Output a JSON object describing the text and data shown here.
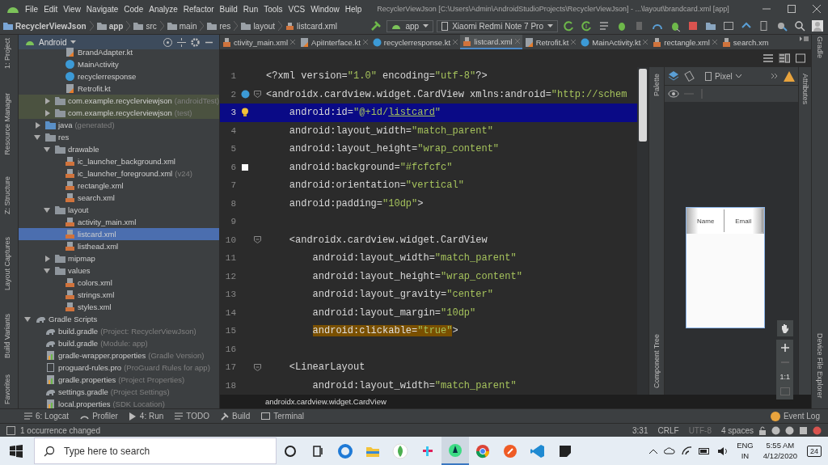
{
  "menu_bar": {
    "items": [
      "File",
      "Edit",
      "View",
      "Navigate",
      "Code",
      "Analyze",
      "Refactor",
      "Build",
      "Run",
      "Tools",
      "VCS",
      "Window",
      "Help"
    ],
    "title": "RecyclerViewJson [C:\\Users\\Admin\\AndroidStudioProjects\\RecyclerViewJson] - ...\\layout\\brandcard.xml [app]"
  },
  "breadcrumbs": [
    {
      "label": "RecyclerViewJson",
      "kind": "project"
    },
    {
      "label": "app",
      "kind": "module"
    },
    {
      "label": "src",
      "kind": "folder"
    },
    {
      "label": "main",
      "kind": "folder"
    },
    {
      "label": "res",
      "kind": "res"
    },
    {
      "label": "layout",
      "kind": "folder"
    },
    {
      "label": "listcard.xml",
      "kind": "xml"
    }
  ],
  "toolbar": {
    "run_config": "app",
    "device": "Xiaomi Redmi Note 7 Pro"
  },
  "left_strip": [
    "1: Project",
    "Resource Manager",
    "Z: Structure",
    "Layout Captures",
    "Build Variants",
    "Favorites"
  ],
  "project": {
    "view": "Android",
    "tree": [
      {
        "children": [
          {
            "children": [
              {
                "children": [
                  {
                    "label": "BrandAdapter.kt",
                    "kind": "kotlin",
                    "selected": false
                  },
                  {
                    "label": "MainActivity",
                    "kind": "class",
                    "selected": false
                  },
                  {
                    "label": "recyclerresponse",
                    "kind": "class",
                    "selected": false
                  },
                  {
                    "label": "Retrofit.kt",
                    "kind": "kotlin",
                    "selected": false
                  }
                ]
              },
              {
                "label": "com.example.recyclerviewjson",
                "note": "(androidTest)",
                "kind": "test-package",
                "expanded": false,
                "selected": false
              },
              {
                "label": "com.example.recyclerviewjson",
                "note": "(test)",
                "kind": "test-package",
                "expanded": false,
                "selected": false
              }
            ]
          },
          {
            "label": "java",
            "note": "(generated)",
            "kind": "generated",
            "expanded": false,
            "selected": false
          },
          {
            "label": "res",
            "kind": "res",
            "expanded": true,
            "selected": false,
            "children": [
              {
                "label": "drawable",
                "kind": "folder",
                "expanded": true,
                "selected": false,
                "children": [
                  {
                    "label": "ic_launcher_background.xml",
                    "kind": "xml",
                    "selected": false
                  },
                  {
                    "label": "ic_launcher_foreground.xml",
                    "note": "(v24)",
                    "kind": "xml",
                    "selected": false
                  },
                  {
                    "label": "rectangle.xml",
                    "kind": "xml",
                    "selected": false
                  },
                  {
                    "label": "search.xml",
                    "kind": "xml",
                    "selected": false
                  }
                ]
              },
              {
                "label": "layout",
                "kind": "folder",
                "expanded": true,
                "selected": false,
                "children": [
                  {
                    "label": "activity_main.xml",
                    "kind": "xml",
                    "selected": false
                  },
                  {
                    "label": "listcard.xml",
                    "kind": "xml",
                    "selected": true
                  },
                  {
                    "label": "listhead.xml",
                    "kind": "xml",
                    "selected": false
                  }
                ]
              },
              {
                "label": "mipmap",
                "kind": "folder",
                "expanded": false,
                "selected": false
              },
              {
                "label": "values",
                "kind": "folder",
                "expanded": true,
                "selected": false,
                "children": [
                  {
                    "label": "colors.xml",
                    "kind": "xml",
                    "selected": false
                  },
                  {
                    "label": "strings.xml",
                    "kind": "xml",
                    "selected": false
                  },
                  {
                    "label": "styles.xml",
                    "kind": "xml",
                    "selected": false
                  }
                ]
              }
            ]
          }
        ]
      },
      {
        "label": "Gradle Scripts",
        "kind": "gradle",
        "expanded": true,
        "selected": false,
        "children": [
          {
            "label": "build.gradle",
            "note": "(Project: RecyclerViewJson)",
            "kind": "gradle",
            "selected": false
          },
          {
            "label": "build.gradle",
            "note": "(Module: app)",
            "kind": "gradle",
            "selected": false
          },
          {
            "label": "gradle-wrapper.properties",
            "note": "(Gradle Version)",
            "kind": "props",
            "selected": false
          },
          {
            "label": "proguard-rules.pro",
            "note": "(ProGuard Rules for app)",
            "kind": "file",
            "selected": false
          },
          {
            "label": "gradle.properties",
            "note": "(Project Properties)",
            "kind": "props",
            "selected": false
          },
          {
            "label": "settings.gradle",
            "note": "(Project Settings)",
            "kind": "gradle",
            "selected": false
          },
          {
            "label": "local.properties",
            "note": "(SDK Location)",
            "kind": "props",
            "selected": false
          }
        ]
      }
    ]
  },
  "tabs": [
    {
      "label": "ctivity_main.xml",
      "kind": "xml",
      "selected": false
    },
    {
      "label": "ApiInterface.kt",
      "kind": "kotlin",
      "selected": false
    },
    {
      "label": "recyclerresponse.kt",
      "kind": "class",
      "selected": false
    },
    {
      "label": "listcard.xml",
      "kind": "xml",
      "selected": true
    },
    {
      "label": "Retrofit.kt",
      "kind": "kotlin",
      "selected": false
    },
    {
      "label": "MainActivity.kt",
      "kind": "class",
      "selected": false
    },
    {
      "label": "rectangle.xml",
      "kind": "xml",
      "selected": false
    },
    {
      "label": "search.xm",
      "kind": "xml",
      "selected": false
    }
  ],
  "editor": {
    "lines": [
      {
        "number": "1",
        "kind": "plain",
        "current": false,
        "fold": false,
        "tokens": [
          {
            "kind": "text",
            "text": "<?xml version="
          },
          {
            "kind": "value",
            "text": "\"1.0\""
          },
          {
            "kind": "text",
            "text": " encoding="
          },
          {
            "kind": "value",
            "text": "\"utf-8\""
          },
          {
            "kind": "text",
            "text": "?>"
          }
        ]
      },
      {
        "number": "2",
        "kind": "class-marker",
        "current": false,
        "fold": true,
        "tokens": [
          {
            "kind": "text",
            "text": "<androidx.cardview.widget.CardView xmlns:android="
          },
          {
            "kind": "value",
            "text": "\"http://schem"
          }
        ]
      },
      {
        "number": "3",
        "kind": "bulb-marker",
        "current": true,
        "fold": false,
        "tokens": [
          {
            "kind": "text",
            "text": "    android:id="
          },
          {
            "kind": "value",
            "text": "\"@+id/"
          },
          {
            "kind": "link",
            "text": "listcard"
          },
          {
            "kind": "value",
            "text": "\""
          }
        ]
      },
      {
        "number": "4",
        "kind": "plain",
        "current": false,
        "fold": false,
        "tokens": [
          {
            "kind": "text",
            "text": "    android:layout_width="
          },
          {
            "kind": "value",
            "text": "\"match_parent\""
          }
        ]
      },
      {
        "number": "5",
        "kind": "plain",
        "current": false,
        "fold": false,
        "tokens": [
          {
            "kind": "text",
            "text": "    android:layout_height="
          },
          {
            "kind": "value",
            "text": "\"wrap_content\""
          }
        ]
      },
      {
        "number": "6",
        "kind": "swatch-marker",
        "current": false,
        "fold": false,
        "tokens": [
          {
            "kind": "text",
            "text": "    android:background="
          },
          {
            "kind": "value",
            "text": "\"#fcfcfc\""
          }
        ]
      },
      {
        "number": "7",
        "kind": "plain",
        "current": false,
        "fold": false,
        "tokens": [
          {
            "kind": "text",
            "text": "    android:orientation="
          },
          {
            "kind": "value",
            "text": "\"vertical\""
          }
        ]
      },
      {
        "number": "8",
        "kind": "plain",
        "current": false,
        "fold": false,
        "tokens": [
          {
            "kind": "text",
            "text": "    android:padding="
          },
          {
            "kind": "value",
            "text": "\"10dp\""
          },
          {
            "kind": "text",
            "text": ">"
          }
        ]
      },
      {
        "number": "9",
        "kind": "plain",
        "current": false,
        "fold": false
      },
      {
        "number": "10",
        "kind": "plain",
        "current": false,
        "fold": true,
        "tokens": [
          {
            "kind": "text",
            "text": "    <androidx.cardview.widget.CardView"
          }
        ]
      },
      {
        "number": "11",
        "kind": "plain",
        "current": false,
        "fold": false,
        "tokens": [
          {
            "kind": "text",
            "text": "        android:layout_width="
          },
          {
            "kind": "value",
            "text": "\"match_parent\""
          }
        ]
      },
      {
        "number": "12",
        "kind": "plain",
        "current": false,
        "fold": false,
        "tokens": [
          {
            "kind": "text",
            "text": "        android:layout_height="
          },
          {
            "kind": "value",
            "text": "\"wrap_content\""
          }
        ]
      },
      {
        "number": "13",
        "kind": "plain",
        "current": false,
        "fold": false,
        "tokens": [
          {
            "kind": "text",
            "text": "        android:layout_gravity="
          },
          {
            "kind": "value",
            "text": "\"center\""
          }
        ]
      },
      {
        "number": "14",
        "kind": "plain",
        "current": false,
        "fold": false,
        "tokens": [
          {
            "kind": "text",
            "text": "        android:layout_margin="
          },
          {
            "kind": "value",
            "text": "\"10dp\""
          }
        ]
      },
      {
        "number": "15",
        "kind": "plain",
        "current": false,
        "fold": false,
        "tokens": [
          {
            "kind": "match-text",
            "text": "        android:clickable="
          },
          {
            "kind": "match-value",
            "text": "\"true\""
          },
          {
            "kind": "text",
            "text": ">"
          }
        ]
      },
      {
        "number": "16",
        "kind": "plain",
        "current": false,
        "fold": false
      },
      {
        "number": "17",
        "kind": "plain",
        "current": false,
        "fold": true,
        "tokens": [
          {
            "kind": "text",
            "text": "    <LinearLayout"
          }
        ]
      },
      {
        "number": "18",
        "kind": "plain",
        "current": false,
        "fold": false,
        "tokens": [
          {
            "kind": "text",
            "text": "        android:layout_width="
          },
          {
            "kind": "value",
            "text": "\"match_parent\""
          }
        ]
      }
    ],
    "breadcrumb": "androidx.cardview.widget.CardView"
  },
  "design": {
    "palette": "Palette",
    "component_tree": "Component Tree",
    "attributes": "Attributes",
    "device": "Pixel",
    "preview_columns": [
      "Name",
      "Email"
    ],
    "zoom_reset": "1:1"
  },
  "right_strip": [
    "Gradle",
    "Device File Explorer"
  ],
  "tool_windows": [
    {
      "label": "6: Logcat",
      "kind": "logcat"
    },
    {
      "label": "Profiler",
      "kind": "profiler"
    },
    {
      "label": "4: Run",
      "kind": "run"
    },
    {
      "label": "TODO",
      "kind": "todo"
    },
    {
      "label": "Build",
      "kind": "build"
    },
    {
      "label": "Terminal",
      "kind": "terminal"
    }
  ],
  "event_log": "Event Log",
  "status": {
    "message": "1 occurrence changed",
    "position": "3:31",
    "line_separator": "CRLF",
    "encoding": "UTF-8",
    "indent": "4 spaces"
  },
  "taskbar": {
    "search_placeholder": "Type here to search",
    "apps": [
      {
        "kind": "cortana",
        "selected": false
      },
      {
        "kind": "taskview",
        "selected": false
      },
      {
        "kind": "edge",
        "selected": false
      },
      {
        "kind": "explorer",
        "selected": false
      },
      {
        "kind": "leaf",
        "selected": false
      },
      {
        "kind": "slack",
        "selected": false
      },
      {
        "kind": "studio",
        "selected": true
      },
      {
        "kind": "chrome",
        "selected": false
      },
      {
        "kind": "postman",
        "selected": false
      },
      {
        "kind": "vscode",
        "selected": false
      },
      {
        "kind": "notes",
        "selected": false
      }
    ],
    "language": "ENG",
    "region": "IN",
    "time": "5:55 AM",
    "date": "4/12/2020",
    "notifications": "24"
  }
}
